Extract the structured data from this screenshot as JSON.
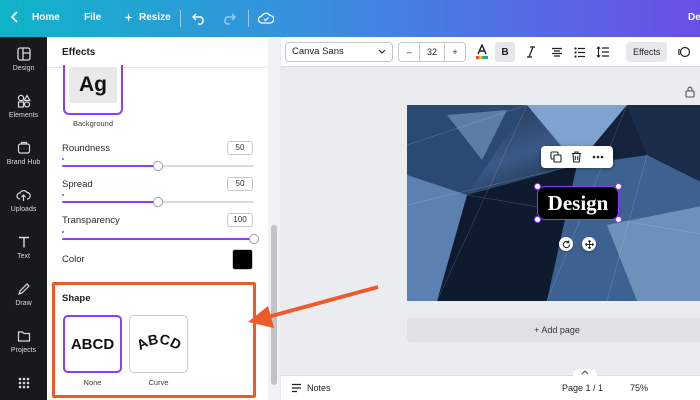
{
  "topbar": {
    "home_label": "Home",
    "file_label": "File",
    "resize_label": "Resize",
    "title_label": "De"
  },
  "leftnav": {
    "items": [
      {
        "label": "Design",
        "icon": "layout-icon"
      },
      {
        "label": "Elements",
        "icon": "shapes-icon"
      },
      {
        "label": "Brand Hub",
        "icon": "brand-icon"
      },
      {
        "label": "Uploads",
        "icon": "upload-cloud-icon"
      },
      {
        "label": "Text",
        "icon": "text-T-icon"
      },
      {
        "label": "Draw",
        "icon": "draw-pen-icon"
      },
      {
        "label": "Projects",
        "icon": "folder-icon"
      },
      {
        "label": "Apps",
        "icon": "grid-dots-icon"
      }
    ]
  },
  "panel": {
    "title": "Effects",
    "background_tile_text": "Ag",
    "background_label": "Background",
    "roundness": {
      "label": "Roundness",
      "value": "50",
      "fraction": 0.5
    },
    "spread": {
      "label": "Spread",
      "value": "50",
      "fraction": 0.5
    },
    "transparency": {
      "label": "Transparency",
      "value": "100",
      "fraction": 1.0
    },
    "color": {
      "label": "Color",
      "swatch": "#000000"
    },
    "shape_title": "Shape",
    "shapes": [
      {
        "text": "ABCD",
        "label": "None",
        "selected": true
      },
      {
        "text": "ABCD",
        "label": "Curve",
        "selected": false
      }
    ]
  },
  "toolbar": {
    "font": "Canva Sans",
    "size": "32",
    "minus": "–",
    "plus": "+",
    "bold": "B",
    "effects": "Effects"
  },
  "canvas": {
    "text_element": "Design",
    "add_page": "+ Add page"
  },
  "bottombar": {
    "notes": "Notes",
    "page_indicator": "Page 1 / 1",
    "zoom": "75%"
  },
  "colors": {
    "accent": "#8b3dff",
    "annotation": "#ee5b2b",
    "topbar_start": "#0fb4c8",
    "topbar_end": "#6a4fe6"
  }
}
